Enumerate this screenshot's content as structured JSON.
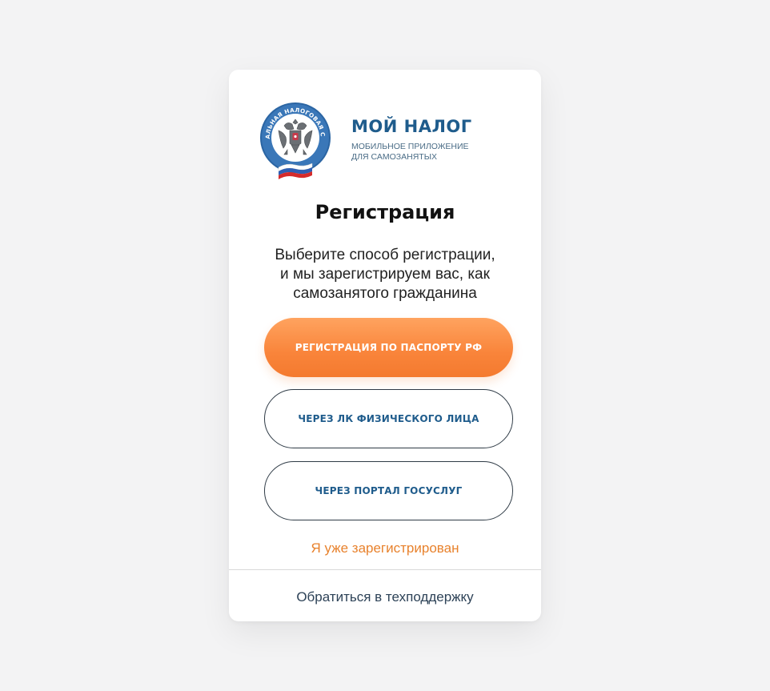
{
  "brand": {
    "title": "МОЙ НАЛОГ",
    "subtitle_line1": "МОБИЛЬНОЕ ПРИЛОЖЕНИЕ",
    "subtitle_line2": "ДЛЯ САМОЗАНЯТЫХ",
    "emblem_text": "ФЕДЕРАЛЬНАЯ НАЛОГОВАЯ СЛУЖБА",
    "emblem_icon": "fns-emblem-icon"
  },
  "page": {
    "title": "Регистрация",
    "description_line1": "Выберите способ регистрации,",
    "description_line2": "и мы зарегистрируем вас, как",
    "description_line3": "самозанятого гражданина"
  },
  "buttons": {
    "passport": "РЕГИСТРАЦИЯ ПО ПАСПОРТУ РФ",
    "lk": "ЧЕРЕЗ ЛК ФИЗИЧЕСКОГО ЛИЦА",
    "gosuslugi": "ЧЕРЕЗ ПОРТАЛ ГОСУСЛУГ"
  },
  "links": {
    "already_registered": "Я уже зарегистрирован",
    "support": "Обратиться в техподдержку"
  },
  "colors": {
    "brand_blue": "#1f5c8c",
    "accent_orange": "#f9843a",
    "link_orange": "#e8822d",
    "page_background": "#f3f3f4"
  }
}
